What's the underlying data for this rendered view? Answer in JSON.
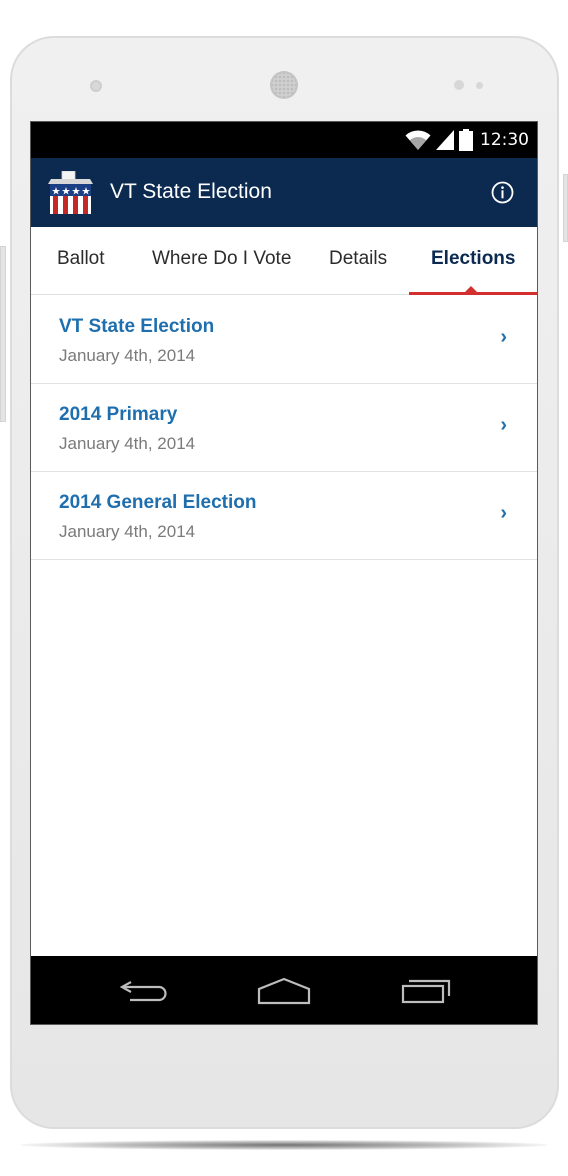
{
  "status_bar": {
    "time": "12:30",
    "icons": [
      "wifi-icon",
      "signal-icon",
      "battery-icon"
    ]
  },
  "app_bar": {
    "title": "VT State Election",
    "logo": "ballot-box-icon",
    "info_icon": "info-icon"
  },
  "tabs": [
    {
      "label": "Ballot",
      "active": false
    },
    {
      "label": "Where Do I Vote",
      "active": false
    },
    {
      "label": "Details",
      "active": false
    },
    {
      "label": "Elections",
      "active": true
    }
  ],
  "elections": [
    {
      "title": "VT State Election",
      "date": "January 4th, 2014"
    },
    {
      "title": "2014 Primary",
      "date": "January 4th, 2014"
    },
    {
      "title": "2014 General Election",
      "date": "January 4th, 2014"
    }
  ],
  "list_chevron": "›",
  "nav_bar": {
    "buttons": [
      "back-icon",
      "home-icon",
      "recent-apps-icon"
    ]
  },
  "colors": {
    "app_bar": "#0c2a50",
    "accent_link": "#1f6fae",
    "tab_indicator": "#d32f2f"
  }
}
